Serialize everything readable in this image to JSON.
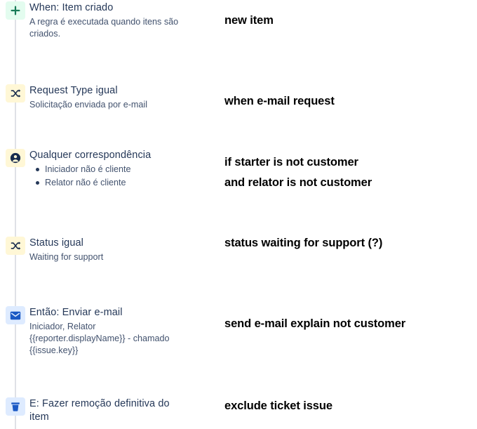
{
  "rule_builder": {
    "rail_color": "#DFE1E6",
    "steps": [
      {
        "icon": "plus-icon",
        "icon_kind": "plus",
        "badge_color": "#E3FCEF",
        "icon_color": "#177B57",
        "title": "When: Item criado",
        "desc": "A regra é executada quando itens são\ncriados.",
        "bullets": []
      },
      {
        "icon": "shuffle-icon",
        "icon_kind": "shuffle",
        "badge_color": "#FFF7D6",
        "icon_color": "#172B4D",
        "title": "Request Type igual",
        "desc": "Solicitação enviada por e-mail",
        "bullets": []
      },
      {
        "icon": "person-circle-icon",
        "icon_kind": "person",
        "badge_color": "#FFF7D6",
        "icon_color": "#172B4D",
        "title": "Qualquer correspondência",
        "desc": "",
        "bullets": [
          "Iniciador não é cliente",
          "Relator não é cliente"
        ]
      },
      {
        "icon": "shuffle-icon",
        "icon_kind": "shuffle",
        "badge_color": "#FFF7D6",
        "icon_color": "#172B4D",
        "title": "Status igual",
        "desc": "Waiting for support",
        "bullets": []
      },
      {
        "icon": "envelope-icon",
        "icon_kind": "envelope",
        "badge_color": "#DEEBFF",
        "icon_color": "#1B59C4",
        "title": "Então: Enviar e-mail",
        "desc": "Iniciador, Relator\n{{reporter.displayName}} - chamado\n{{issue.key}}",
        "bullets": []
      },
      {
        "icon": "trash-icon",
        "icon_kind": "trash",
        "badge_color": "#DEEBFF",
        "icon_color": "#1B59C4",
        "title": "E: Fazer remoção definitiva do\nitem",
        "desc": "",
        "bullets": []
      }
    ]
  },
  "annotations": [
    {
      "text": "new item"
    },
    {
      "text": "when e-mail request"
    },
    {
      "text": "if starter is not customer\nand  relator is not customer"
    },
    {
      "text": "status waiting for support (?)"
    },
    {
      "text": "send e-mail explain not customer"
    },
    {
      "text": "exclude ticket issue"
    }
  ]
}
